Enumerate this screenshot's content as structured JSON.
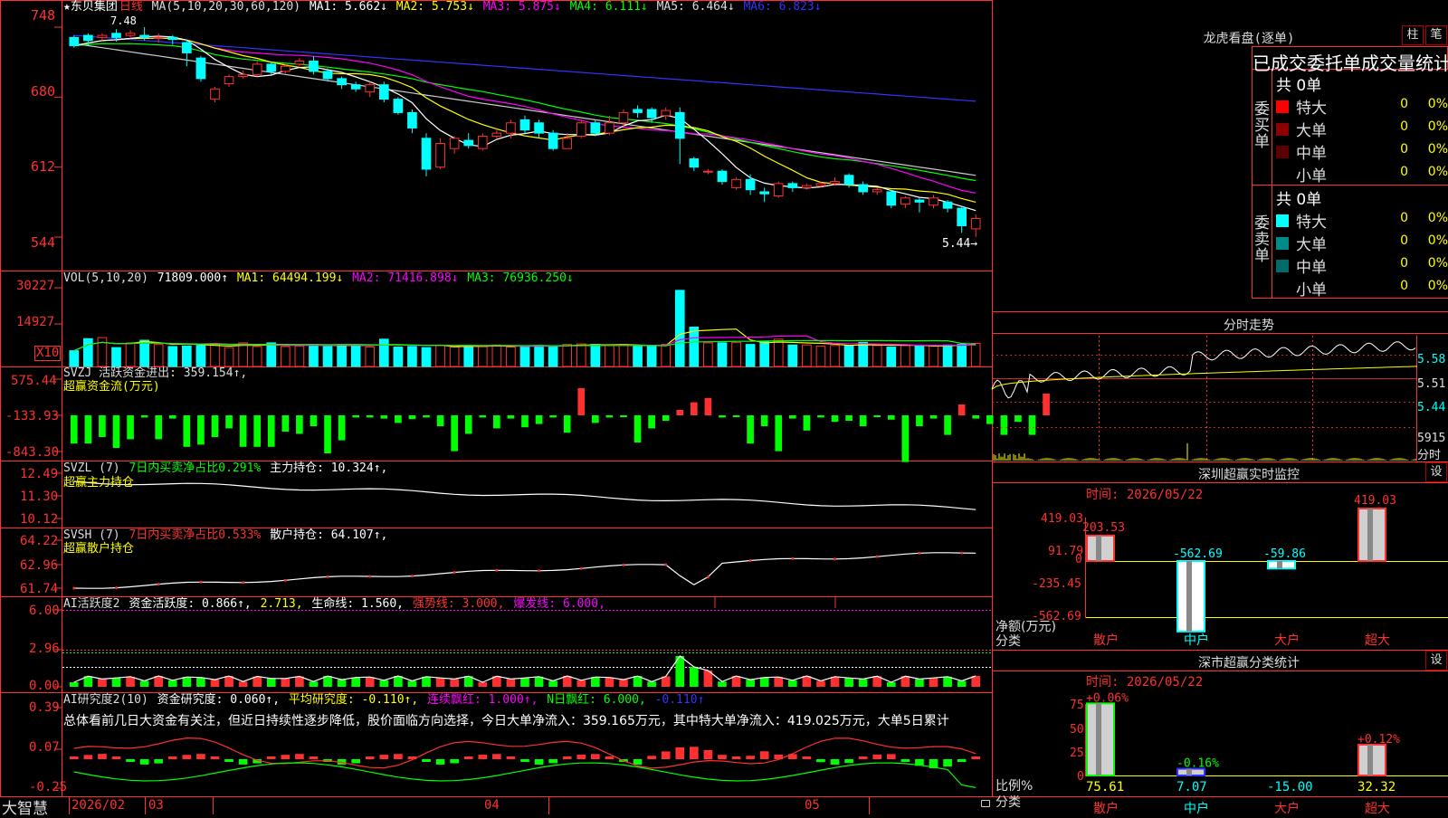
{
  "stock": {
    "name": "★东贝集团",
    "period": "日线"
  },
  "price_panel": {
    "ma_header": {
      "label": "MA(5,10,20,30,60,120)",
      "ma1": "MA1: 5.662↓",
      "ma2": "MA2: 5.753↓",
      "ma3": "MA3: 5.875↓",
      "ma4": "MA4: 6.111↓",
      "ma5": "MA5: 6.464↓",
      "ma6": "MA6: 6.823↓"
    },
    "ticks": [
      "748",
      "680",
      "612",
      "544"
    ],
    "low_marker": "5.44→",
    "high_marker": "7.48"
  },
  "vol_panel": {
    "header": {
      "label": "VOL(5,10,20)",
      "v": "71809.000↑",
      "ma1": "MA1: 64494.199↓",
      "ma2": "MA2: 71416.898↓",
      "ma3": "MA3: 76936.250↓"
    },
    "ticks": [
      "30227",
      "14927"
    ],
    "unit": "X10"
  },
  "svzj_panel": {
    "header1": "SVZJ  活跃资金进出: 359.154↑,",
    "header2": "超赢资金流(万元)",
    "ticks": [
      "575.44",
      "-133.93",
      "-843.30"
    ]
  },
  "svzl_panel": {
    "header": {
      "a": "SVZL (7)",
      "b": "7日内买卖净占比0.291%",
      "c": "主力持仓: 10.324↑,"
    },
    "header2": "超赢主力持仓",
    "ticks": [
      "12.49",
      "11.30",
      "10.12"
    ]
  },
  "svsh_panel": {
    "header": {
      "a": "SVSH (7)",
      "b": "7日内买卖净占比0.533%",
      "c": "散户持仓: 64.107↑,"
    },
    "header2": "超赢散户持仓",
    "ticks": [
      "64.22",
      "62.96",
      "61.74"
    ]
  },
  "ai_active_panel": {
    "header": {
      "a": "AI活跃度2",
      "b": "资金活跃度: 0.866↑,",
      "c": "2.713,",
      "d": "生命线: 1.560,",
      "e": "强势线: 3.000,",
      "f": "爆发线: 6.000,"
    },
    "ticks": [
      "6.00",
      "2.96",
      "0.00"
    ]
  },
  "ai_research_panel": {
    "header": {
      "a": "AI研究度2(10)",
      "b": "资金研究度: 0.060↑,",
      "c": "平均研究度: -0.110↑,",
      "d": "连续飘红: 1.000↑,",
      "e": "N日飘红: 6.000,",
      "f": "-0.110↑"
    },
    "summary": "总体看前几日大资金有关注，但近日持续性逐步降低，股价面临方向选择，今日大单净流入：359.165万元，其中特大单净流入：419.025万元，大单5日累计",
    "ticks": [
      "0.39",
      "0.07",
      "-0.25"
    ]
  },
  "bottom_axis": {
    "brand": "大智慧",
    "labels": [
      "2026/02",
      "03",
      "04",
      "05"
    ]
  },
  "right_panel": {
    "dragon": {
      "title": "龙虎看盘(逐单)",
      "btn1": "柱",
      "btn2": "笔",
      "subtitle": "已成交委托单成交量统计",
      "buy": {
        "label": "委买单",
        "total": "共 0单",
        "rows": [
          {
            "name": "特大",
            "count": "0",
            "pct": "0%",
            "color": "#ff0000"
          },
          {
            "name": "大单",
            "count": "0",
            "pct": "0%",
            "color": "#8b0000"
          },
          {
            "name": "中单",
            "count": "0",
            "pct": "0%",
            "color": "#5a0000"
          },
          {
            "name": "小单",
            "count": "0",
            "pct": "0%",
            "color": "#000000"
          }
        ]
      },
      "sell": {
        "label": "委卖单",
        "total": "共 0单",
        "rows": [
          {
            "name": "特大",
            "count": "0",
            "pct": "0%",
            "color": "#00ffff"
          },
          {
            "name": "大单",
            "count": "0",
            "pct": "0%",
            "color": "#008b8b"
          },
          {
            "name": "中单",
            "count": "0",
            "pct": "0%",
            "color": "#006b6b"
          },
          {
            "name": "小单",
            "count": "0",
            "pct": "0%",
            "color": "#000000"
          }
        ]
      }
    },
    "intraday": {
      "title": "分时走势",
      "ticks": [
        "5.58",
        "5.51",
        "5.44"
      ],
      "vol_tick": "5915",
      "vol_label": "分时"
    },
    "sz_monitor": {
      "title": "深圳超赢实时监控",
      "btn": "设",
      "time": "时间: 2026/05/22",
      "ticks": [
        "419.03",
        "91.79",
        "0",
        "-235.45",
        "-562.69"
      ],
      "ylabel": "净额(万元)",
      "xlabel": "分类",
      "categories": [
        "散户",
        "中户",
        "大户",
        "超大"
      ],
      "values": [
        203.53,
        -562.69,
        -59.86,
        419.03
      ],
      "value_labels": [
        "203.53",
        "-562.69",
        "-59.86",
        "419.03"
      ]
    },
    "sz_class": {
      "title": "深市超赢分类统计",
      "btn": "设",
      "time": "时间: 2026/05/22",
      "ticks": [
        "75",
        "50",
        "25",
        "0"
      ],
      "ylabel": "比例%",
      "xlabel": "分类",
      "categories": [
        "散户",
        "中户",
        "大户",
        "超大"
      ],
      "values": [
        75.61,
        7.07,
        -15.0,
        32.32
      ],
      "bottom_labels": [
        "75.61",
        "7.07",
        "-15.00",
        "32.32"
      ],
      "changes": [
        "+0.06%",
        "-0.16%",
        "",
        "+0.12%"
      ]
    }
  },
  "chart_data": {
    "type": "candlestick",
    "title": "东贝集团 日线",
    "x_labels": [
      "2026/02",
      "03",
      "04",
      "05"
    ],
    "ylim": [
      5.44,
      7.48
    ],
    "candles": [
      {
        "o": 7.38,
        "c": 7.3,
        "h": 7.4,
        "l": 7.28
      },
      {
        "o": 7.4,
        "c": 7.35,
        "h": 7.42,
        "l": 7.3
      },
      {
        "o": 7.38,
        "c": 7.4,
        "h": 7.42,
        "l": 7.35
      },
      {
        "o": 7.42,
        "c": 7.38,
        "h": 7.46,
        "l": 7.34
      },
      {
        "o": 7.4,
        "c": 7.42,
        "h": 7.45,
        "l": 7.37
      },
      {
        "o": 7.4,
        "c": 7.38,
        "h": 7.48,
        "l": 7.35
      },
      {
        "o": 7.38,
        "c": 7.38,
        "h": 7.42,
        "l": 7.33
      },
      {
        "o": 7.38,
        "c": 7.36,
        "h": 7.4,
        "l": 7.31
      },
      {
        "o": 7.33,
        "c": 7.23,
        "h": 7.36,
        "l": 7.1
      },
      {
        "o": 7.18,
        "c": 6.98,
        "h": 7.2,
        "l": 6.95
      },
      {
        "o": 6.78,
        "c": 6.88,
        "h": 6.9,
        "l": 6.75
      },
      {
        "o": 6.93,
        "c": 7.0,
        "h": 7.02,
        "l": 6.9
      },
      {
        "o": 7.0,
        "c": 7.02,
        "h": 7.06,
        "l": 6.98
      },
      {
        "o": 7.02,
        "c": 7.12,
        "h": 7.15,
        "l": 7.0
      },
      {
        "o": 7.12,
        "c": 7.05,
        "h": 7.14,
        "l": 7.02
      },
      {
        "o": 7.05,
        "c": 7.1,
        "h": 7.12,
        "l": 7.03
      },
      {
        "o": 7.12,
        "c": 7.15,
        "h": 7.18,
        "l": 7.1
      },
      {
        "o": 7.15,
        "c": 7.05,
        "h": 7.2,
        "l": 7.02
      },
      {
        "o": 7.05,
        "c": 6.98,
        "h": 7.08,
        "l": 6.95
      },
      {
        "o": 6.98,
        "c": 6.92,
        "h": 7.0,
        "l": 6.88
      },
      {
        "o": 6.92,
        "c": 6.88,
        "h": 6.95,
        "l": 6.85
      },
      {
        "o": 6.85,
        "c": 6.92,
        "h": 6.95,
        "l": 6.8
      },
      {
        "o": 6.92,
        "c": 6.78,
        "h": 6.95,
        "l": 6.75
      },
      {
        "o": 6.78,
        "c": 6.65,
        "h": 6.8,
        "l": 6.63
      },
      {
        "o": 6.65,
        "c": 6.5,
        "h": 6.68,
        "l": 6.45
      },
      {
        "o": 6.4,
        "c": 6.1,
        "h": 6.45,
        "l": 6.03
      },
      {
        "o": 6.12,
        "c": 6.35,
        "h": 6.4,
        "l": 6.1
      },
      {
        "o": 6.3,
        "c": 6.4,
        "h": 6.42,
        "l": 6.25
      },
      {
        "o": 6.38,
        "c": 6.33,
        "h": 6.45,
        "l": 6.3
      },
      {
        "o": 6.3,
        "c": 6.42,
        "h": 6.45,
        "l": 6.28
      },
      {
        "o": 6.42,
        "c": 6.45,
        "h": 6.48,
        "l": 6.4
      },
      {
        "o": 6.45,
        "c": 6.55,
        "h": 6.58,
        "l": 6.4
      },
      {
        "o": 6.58,
        "c": 6.48,
        "h": 6.62,
        "l": 6.45
      },
      {
        "o": 6.55,
        "c": 6.45,
        "h": 6.58,
        "l": 6.4
      },
      {
        "o": 6.45,
        "c": 6.3,
        "h": 6.48,
        "l": 6.28
      },
      {
        "o": 6.3,
        "c": 6.4,
        "h": 6.45,
        "l": 6.3
      },
      {
        "o": 6.42,
        "c": 6.55,
        "h": 6.58,
        "l": 6.4
      },
      {
        "o": 6.55,
        "c": 6.45,
        "h": 6.58,
        "l": 6.42
      },
      {
        "o": 6.45,
        "c": 6.55,
        "h": 6.62,
        "l": 6.43
      },
      {
        "o": 6.55,
        "c": 6.65,
        "h": 6.68,
        "l": 6.5
      },
      {
        "o": 6.68,
        "c": 6.65,
        "h": 6.72,
        "l": 6.6
      },
      {
        "o": 6.68,
        "c": 6.6,
        "h": 6.7,
        "l": 6.55
      },
      {
        "o": 6.62,
        "c": 6.67,
        "h": 6.7,
        "l": 6.58
      },
      {
        "o": 6.65,
        "c": 6.4,
        "h": 6.7,
        "l": 6.15
      },
      {
        "o": 6.2,
        "c": 6.12,
        "h": 6.22,
        "l": 6.08
      },
      {
        "o": 6.08,
        "c": 6.08,
        "h": 6.1,
        "l": 6.05
      },
      {
        "o": 6.08,
        "c": 5.98,
        "h": 6.1,
        "l": 5.95
      },
      {
        "o": 5.92,
        "c": 6.0,
        "h": 6.02,
        "l": 5.9
      },
      {
        "o": 6.0,
        "c": 5.9,
        "h": 6.05,
        "l": 5.85
      },
      {
        "o": 5.88,
        "c": 5.86,
        "h": 5.92,
        "l": 5.78
      },
      {
        "o": 5.84,
        "c": 5.96,
        "h": 5.98,
        "l": 5.82
      },
      {
        "o": 5.96,
        "c": 5.92,
        "h": 5.98,
        "l": 5.88
      },
      {
        "o": 5.92,
        "c": 5.94,
        "h": 5.96,
        "l": 5.9
      },
      {
        "o": 5.94,
        "c": 5.96,
        "h": 5.98,
        "l": 5.92
      },
      {
        "o": 5.96,
        "c": 5.98,
        "h": 6.02,
        "l": 5.94
      },
      {
        "o": 6.04,
        "c": 5.95,
        "h": 6.06,
        "l": 5.92
      },
      {
        "o": 5.95,
        "c": 5.88,
        "h": 5.98,
        "l": 5.85
      },
      {
        "o": 5.88,
        "c": 5.9,
        "h": 5.92,
        "l": 5.85
      },
      {
        "o": 5.88,
        "c": 5.75,
        "h": 5.9,
        "l": 5.72
      },
      {
        "o": 5.76,
        "c": 5.82,
        "h": 5.84,
        "l": 5.72
      },
      {
        "o": 5.8,
        "c": 5.78,
        "h": 5.82,
        "l": 5.68
      },
      {
        "o": 5.75,
        "c": 5.82,
        "h": 5.85,
        "l": 5.72
      },
      {
        "o": 5.78,
        "c": 5.72,
        "h": 5.8,
        "l": 5.68
      },
      {
        "o": 5.72,
        "c": 5.55,
        "h": 5.74,
        "l": 5.48
      },
      {
        "o": 5.52,
        "c": 5.62,
        "h": 5.66,
        "l": 5.44
      }
    ],
    "volume": [
      3000,
      5300,
      5500,
      3600,
      4500,
      5000,
      4200,
      3800,
      3900,
      4000,
      4200,
      3600,
      4500,
      3800,
      4500,
      3800,
      3900,
      4200,
      3800,
      4200,
      4000,
      3700,
      5200,
      3700,
      3800,
      3600,
      4000,
      3700,
      4000,
      3800,
      4100,
      3700,
      3900,
      4000,
      3900,
      4200,
      4300,
      4200,
      4000,
      4200,
      3800,
      3800,
      4200,
      14500,
      7500,
      4500,
      4500,
      4600,
      4200,
      4800,
      5200,
      4100,
      4100,
      3900,
      4000,
      4000,
      4600,
      4000,
      3700,
      4000,
      3900,
      3900,
      4100,
      4200,
      4400
    ],
    "svzj": [
      -260,
      -260,
      -200,
      -300,
      -220,
      -20,
      -220,
      -30,
      -290,
      -270,
      -200,
      -120,
      -290,
      -290,
      -290,
      -150,
      -170,
      -100,
      -350,
      -230,
      -20,
      -20,
      -30,
      -70,
      -35,
      -20,
      -100,
      -330,
      -170,
      -20,
      -120,
      -30,
      -110,
      -80,
      -20,
      -160,
      250,
      -70,
      -20,
      -10,
      -250,
      -120,
      -50,
      50,
      120,
      160,
      -20,
      -10,
      -260,
      -100,
      -330,
      -30,
      -140,
      -20,
      -60,
      -50,
      -100,
      -10,
      -40,
      -430,
      -100,
      -30,
      -180,
      100,
      -30,
      -80,
      -180,
      -60,
      -180,
      200
    ]
  }
}
